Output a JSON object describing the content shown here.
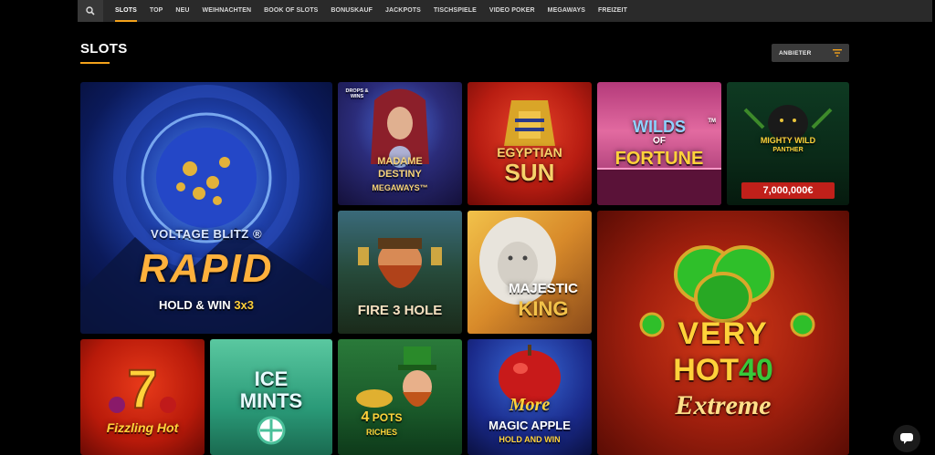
{
  "nav": {
    "items": [
      "SLOTS",
      "TOP",
      "NEU",
      "WEIHNACHTEN",
      "BOOK OF SLOTS",
      "BONUSKAUF",
      "JACKPOTS",
      "TISCHSPIELE",
      "VIDEO POKER",
      "MEGAWAYS",
      "FREIZEIT"
    ],
    "active": "SLOTS"
  },
  "page": {
    "title": "SLOTS"
  },
  "filter": {
    "provider_label": "ANBIETER"
  },
  "colors": {
    "accent": "#f3a21b",
    "nav_bg": "#2a2a2a",
    "background": "#000000"
  },
  "games": {
    "voltage": {
      "brand": "VOLTAGE BLITZ",
      "reg": "®",
      "title": "RAPID",
      "subtitle": "HOLD & WIN",
      "suffix": "3x3"
    },
    "madame": {
      "badge": "DROPS & WINS",
      "line1": "MADAME",
      "line2": "DESTINY",
      "line3": "MEGAWAYS™"
    },
    "egyptian": {
      "line1": "EGYPTIAN",
      "line2": "SUN"
    },
    "wilds": {
      "line1": "WILDS",
      "line2": "OF",
      "line3": "FORTUNE",
      "tm": "TM"
    },
    "panther": {
      "line1": "MIGHTY",
      "line2": "WILD",
      "line3": "PANTHER",
      "jackpot": "7,000,000€"
    },
    "firehole": {
      "title": "FIRE 3 HOLE"
    },
    "majestic": {
      "line1": "MAJESTIC",
      "line2": "KING"
    },
    "veryhot": {
      "line1": "VERY",
      "line2": "HOT",
      "number": "40",
      "line3": "Extreme"
    },
    "fizzling": {
      "title": "Fizzling Hot"
    },
    "icemints": {
      "line1": "ICE",
      "line2": "MINTS"
    },
    "pots": {
      "line1": "4",
      "line2": "POTS",
      "line3": "RICHES"
    },
    "apple": {
      "line1": "More",
      "line2": "MAGIC APPLE",
      "line3": "HOLD AND WIN"
    }
  }
}
